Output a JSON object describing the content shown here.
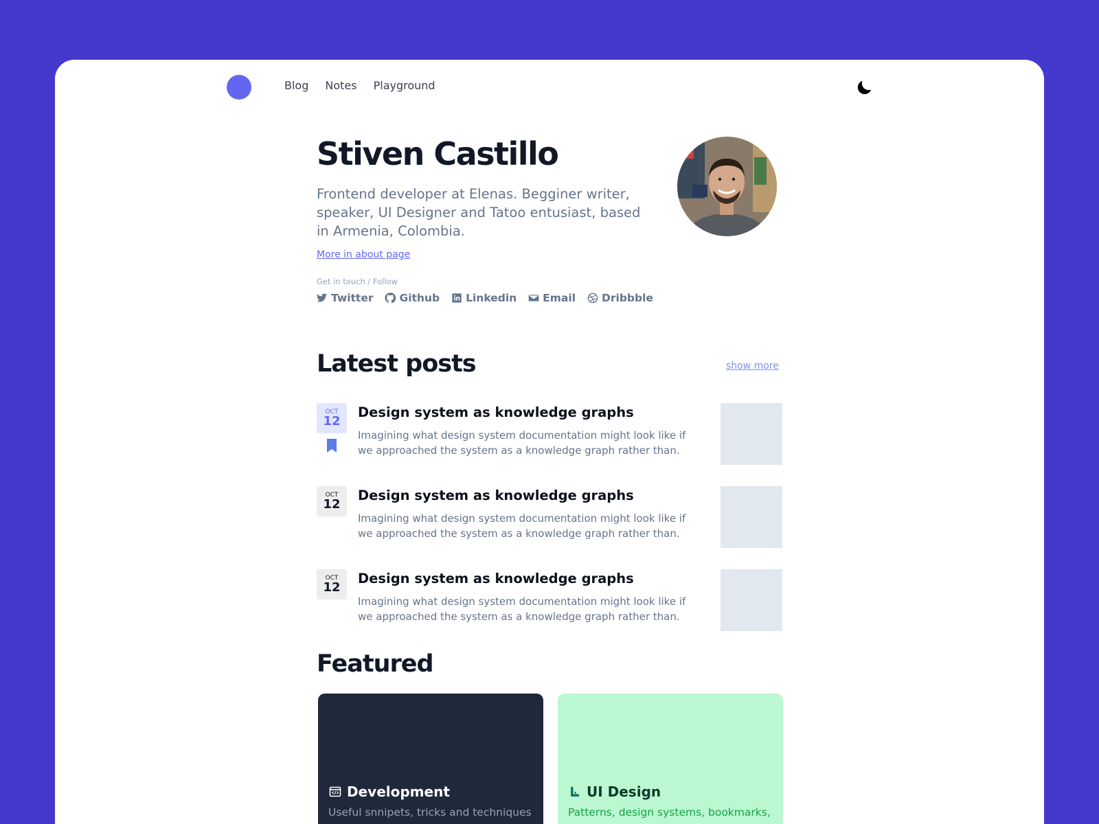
{
  "nav": {
    "links": [
      "Blog",
      "Notes",
      "Playground"
    ],
    "theme_toggle_icon": "moon-icon"
  },
  "profile": {
    "name": "Stiven Castillo",
    "bio": "Frontend developer at Elenas. Begginer writer, speaker, UI Designer and Tatoo entusiast, based in Armenia, Colombia.",
    "about_link": "More in about page",
    "follow_label": "Get in touch / Follow",
    "socials": [
      {
        "label": "Twitter",
        "icon": "twitter-icon"
      },
      {
        "label": "Github",
        "icon": "github-icon"
      },
      {
        "label": "Linkedin",
        "icon": "linkedin-icon"
      },
      {
        "label": "Email",
        "icon": "email-icon"
      },
      {
        "label": "Dribbble",
        "icon": "dribbble-icon"
      }
    ]
  },
  "latest": {
    "title": "Latest posts",
    "show_more": "show more",
    "posts": [
      {
        "month": "OCT",
        "day": "12",
        "title": "Design system as knowledge graphs",
        "desc": "Imagining what design system documentation might look like if we approached the system as a knowledge graph rather than.",
        "bookmarked": true
      },
      {
        "month": "OCT",
        "day": "12",
        "title": "Design system as knowledge graphs",
        "desc": "Imagining what design system documentation might look like if we approached the system as a knowledge graph rather than.",
        "bookmarked": false
      },
      {
        "month": "OCT",
        "day": "12",
        "title": "Design system as knowledge graphs",
        "desc": "Imagining what design system documentation might look like if we approached the system as a knowledge graph rather than.",
        "bookmarked": false
      }
    ]
  },
  "featured": {
    "title": "Featured",
    "cards": [
      {
        "title": "Development",
        "desc": "Useful snnipets, tricks and techniques",
        "icon": "code-window-icon",
        "bg": "#1f293b"
      },
      {
        "title": "UI Design",
        "desc": "Patterns, design systems, bookmarks,",
        "icon": "ui-design-icon",
        "bg": "#bbf7d0"
      }
    ]
  },
  "colors": {
    "background": "#4538cc",
    "accent": "#6366f1",
    "text_dark": "#111827",
    "text_muted": "#64748b"
  }
}
